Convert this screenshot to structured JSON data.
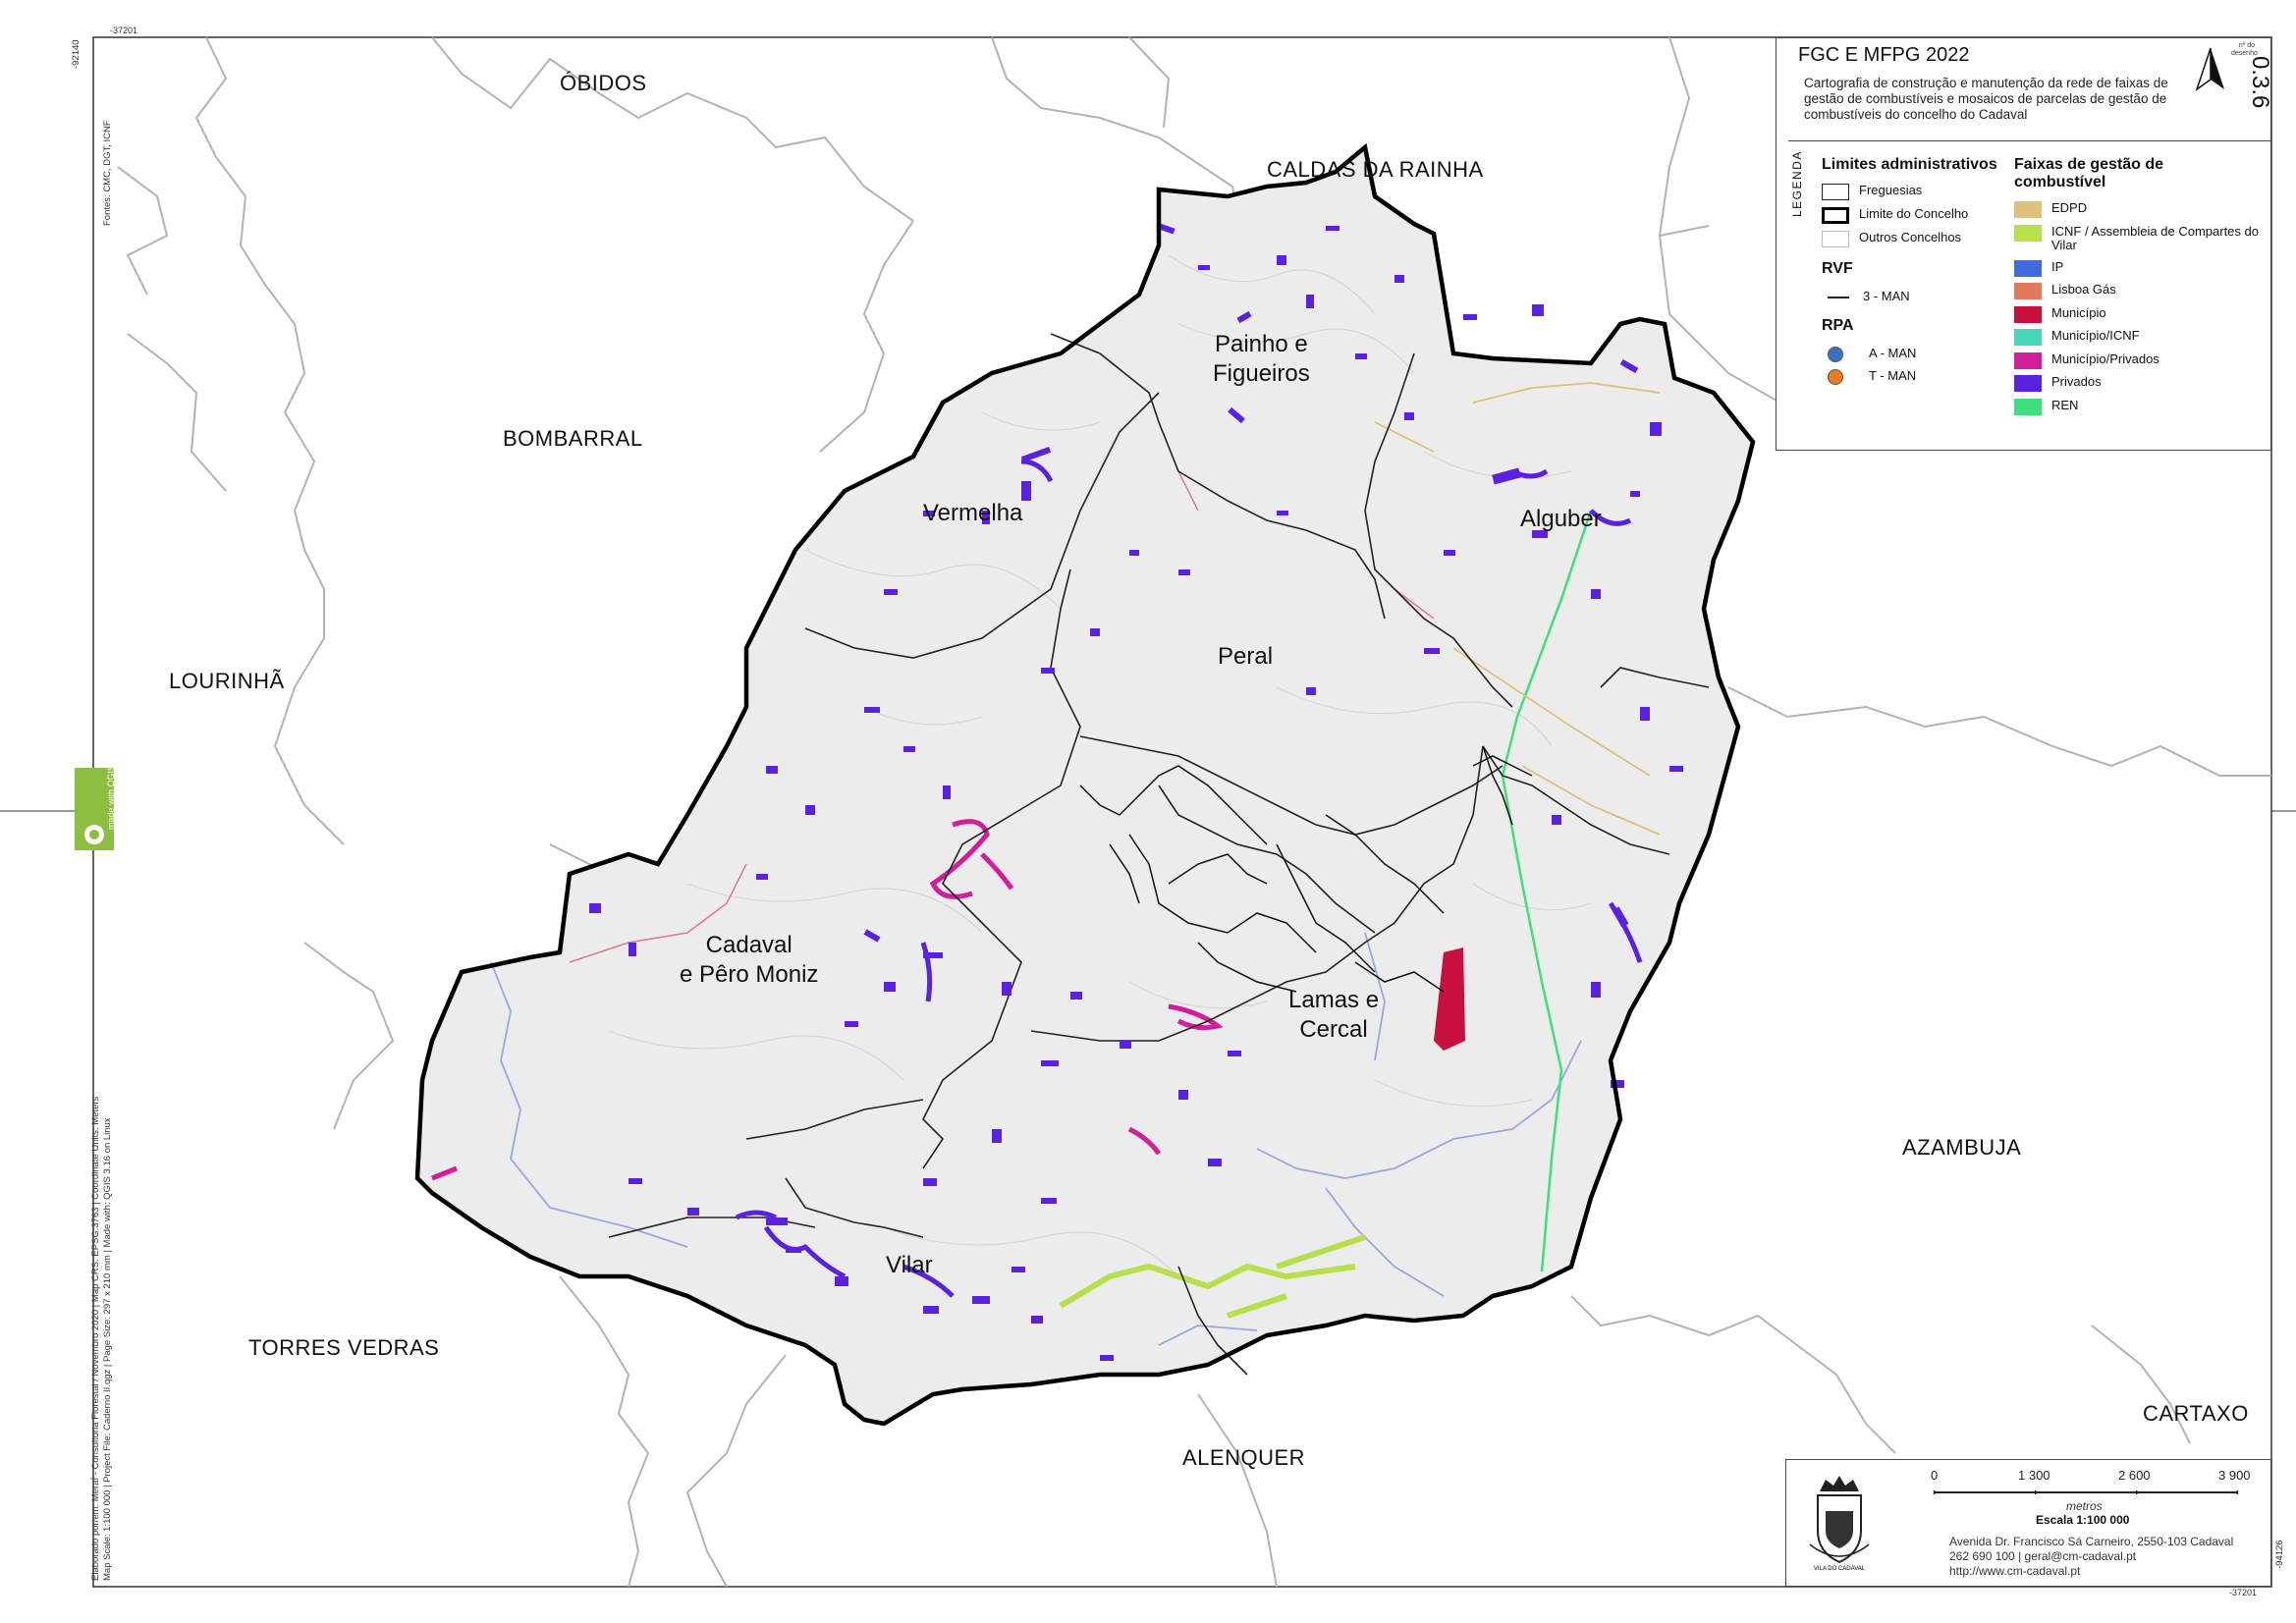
{
  "header": {
    "title": "FGC E MFPG 2022",
    "description": "Cartografia de construção e manutenção da rede de faixas de gestão de combustíveis e mosaicos de parcelas de gestão de combustíveis do concelho do Cadaval",
    "sheet_label": "nº do desenho",
    "sheet_number": "0.3.6"
  },
  "legend": {
    "legend_word": "LEGENDA",
    "admin_heading": "Limites administrativos",
    "admin_items": [
      "Freguesias",
      "Limite do Concelho",
      "Outros Concelhos"
    ],
    "rvf_heading": "RVF",
    "rvf_item": "3 - MAN",
    "rpa_heading": "RPA",
    "rpa_items": [
      {
        "label": "A - MAN",
        "color": "#3b6fc4"
      },
      {
        "label": "T - MAN",
        "color": "#f07a1e"
      }
    ],
    "fgc_heading": "Faixas de gestão de combustível",
    "fgc_items": [
      {
        "label": "EDPD",
        "color": "#e0c07a"
      },
      {
        "label": "ICNF / Assembleia de Compartes do Vilar",
        "color": "#b6e04e"
      },
      {
        "label": "IP",
        "color": "#3e6be0"
      },
      {
        "label": "Lisboa Gás",
        "color": "#e07a5a"
      },
      {
        "label": "Município",
        "color": "#c8103e"
      },
      {
        "label": "Município/ICNF",
        "color": "#46d6b8"
      },
      {
        "label": "Município/Privados",
        "color": "#d21e9a"
      },
      {
        "label": "Privados",
        "color": "#5a22e0"
      },
      {
        "label": "REN",
        "color": "#3fe07a"
      }
    ]
  },
  "map": {
    "neighbors": [
      "ÓBIDOS",
      "CALDAS DA RAINHA",
      "BOMBARRAL",
      "LOURINHÃ",
      "TORRES VEDRAS",
      "ALENQUER",
      "AZAMBUJA",
      "CARTAXO"
    ],
    "parishes": [
      "Painho e\nFigueiros",
      "Vermelha",
      "Alguber",
      "Peral",
      "Cadaval\ne Pêro Moniz",
      "Lamas e\nCercal",
      "Vilar"
    ],
    "frame_coords": {
      "top_left": "-37201",
      "side_top": "-92140",
      "side_bottom": "-94126",
      "bottom_right": "-37201"
    },
    "sources": "Fontes: CMC, DGT, ICNF",
    "credits_1": "Elaborado por/em: MeraÍ - Consultoria Florestal / Novembro 2020 | Map CRS: EPSG:3763 | Coordinate Units: Meters",
    "credits_2": "Map Scale: 1:100 000 | Project File: Caderno II.qgz | Page Size: 297 x 210 mm | Made with: QGIS 3.16 on Linux",
    "qgis_badge": "made with QGIS"
  },
  "footer": {
    "scale_ticks": [
      "0",
      "1 300",
      "2 600",
      "3 900"
    ],
    "units": "metros",
    "scale": "Escala 1:100 000",
    "crest_text": "VILA DO CADAVAL",
    "address_lines": [
      "Avenida Dr. Francisco Sá Carneiro, 2550-103 Cadaval",
      "262 690 100 | geral@cm-cadaval.pt",
      "http://www.cm-cadaval.pt"
    ]
  }
}
